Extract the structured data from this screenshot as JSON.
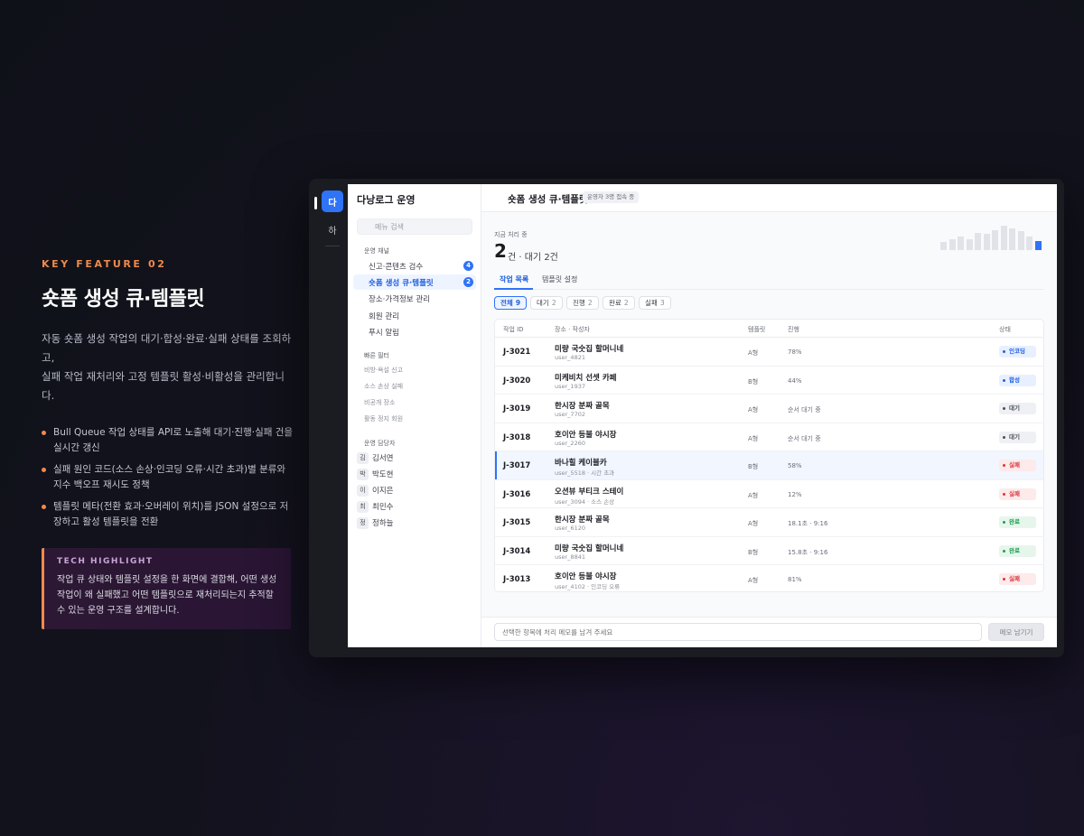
{
  "feature": {
    "kicker": "KEY FEATURE 02",
    "title": "숏폼 생성 큐·템플릿",
    "desc_line1": "자동 숏폼 생성 작업의 대기·합성·완료·실패 상태를 조회하고,",
    "desc_line2": "실패 작업 재처리와 고정 템플릿 활성·비활성을 관리합니다.",
    "bullets": [
      "Bull Queue 작업 상태를 API로 노출해 대기·진행·실패 건을 실시간 갱신",
      "실패 원인 코드(소스 손상·인코딩 오류·시간 초과)별 분류와 지수 백오프 재시도 정책",
      "템플릿 메타(전환 효과·오버레이 위치)를 JSON 설정으로 저장하고 활성 템플릿을 전환"
    ],
    "tech_title": "TECH HIGHLIGHT",
    "tech_body": "작업 큐 상태와 템플릿 설정을 한 화면에 결합해, 어떤 생성 작업이 왜 실패했고 어떤 템플릿으로 재처리되는지 추적할 수 있는 운영 구조를 설계합니다."
  },
  "rail": {
    "active": "다",
    "second": "하"
  },
  "sidebar": {
    "brand": "다낭로그 운영",
    "search_placeholder": "메뉴 검색",
    "ops_label": "운영 채널",
    "nav": [
      {
        "label": "신고·콘텐츠 검수",
        "badge": "4"
      },
      {
        "label": "숏폼 생성 큐·템플릿",
        "badge": "2"
      },
      {
        "label": "장소·가격정보 관리"
      },
      {
        "label": "회원 관리"
      },
      {
        "label": "푸시 알림"
      }
    ],
    "quick_label": "빠른 필터",
    "filters": [
      "비방·욕설 신고",
      "소스 손상 실패",
      "비공개 장소",
      "활동 정지 회원"
    ],
    "staff_label": "운영 담당자",
    "staff": [
      {
        "initial": "김",
        "name": "김서연"
      },
      {
        "initial": "박",
        "name": "박도현"
      },
      {
        "initial": "이",
        "name": "이지은"
      },
      {
        "initial": "최",
        "name": "최민수"
      },
      {
        "initial": "정",
        "name": "정하늘"
      }
    ]
  },
  "header": {
    "title": "숏폼 생성 큐·템플릿",
    "presence": "운영자 3명 접속 중"
  },
  "summary": {
    "label": "지금 처리 중",
    "count": "2",
    "suffix": "건 · 대기 2건",
    "spark": [
      0.3,
      0.4,
      0.5,
      0.4,
      0.65,
      0.6,
      0.75,
      0.9,
      0.8,
      0.7,
      0.5,
      0.35
    ]
  },
  "tabs": [
    "작업 목록",
    "템플릿 설정"
  ],
  "chips": [
    {
      "label": "전체",
      "count": "9"
    },
    {
      "label": "대기",
      "count": "2"
    },
    {
      "label": "진행",
      "count": "2"
    },
    {
      "label": "완료",
      "count": "2"
    },
    {
      "label": "실패",
      "count": "3"
    }
  ],
  "table": {
    "headers": [
      "작업 ID",
      "장소 · 작성자",
      "템플릿",
      "진행",
      "상태"
    ],
    "rows": [
      {
        "id": "J-3021",
        "place": "미량 국숫집 할머니네",
        "user": "user_4821",
        "tpl": "A형",
        "prog": "78%",
        "status": "인코딩",
        "kind": "enc"
      },
      {
        "id": "J-3020",
        "place": "미케비치 선셋 카페",
        "user": "user_1937",
        "tpl": "B형",
        "prog": "44%",
        "status": "합성",
        "kind": "enc"
      },
      {
        "id": "J-3019",
        "place": "한시장 분짜 골목",
        "user": "user_7702",
        "tpl": "A형",
        "prog": "순서 대기 중",
        "status": "대기",
        "kind": "wait"
      },
      {
        "id": "J-3018",
        "place": "호이안 등불 야시장",
        "user": "user_2260",
        "tpl": "A형",
        "prog": "순서 대기 중",
        "status": "대기",
        "kind": "wait"
      },
      {
        "id": "J-3017",
        "place": "바나힐 케이블카",
        "user": "user_5518 · 시간 초과",
        "tpl": "B형",
        "prog": "58%",
        "status": "실패",
        "kind": "fail"
      },
      {
        "id": "J-3016",
        "place": "오션뷰 부티크 스테이",
        "user": "user_3094 · 소스 손상",
        "tpl": "A형",
        "prog": "12%",
        "status": "실패",
        "kind": "fail"
      },
      {
        "id": "J-3015",
        "place": "한시장 분짜 골목",
        "user": "user_6120",
        "tpl": "A형",
        "prog": "18.1초 · 9:16",
        "status": "완료",
        "kind": "done"
      },
      {
        "id": "J-3014",
        "place": "미량 국숫집 할머니네",
        "user": "user_8841",
        "tpl": "B형",
        "prog": "15.8초 · 9:16",
        "status": "완료",
        "kind": "done"
      },
      {
        "id": "J-3013",
        "place": "호이안 등불 야시장",
        "user": "user_4102 · 인코딩 오류",
        "tpl": "A형",
        "prog": "81%",
        "status": "실패",
        "kind": "fail"
      }
    ]
  },
  "status_colors": {
    "enc": {
      "fg": "#1f5fe0",
      "bg": "#e8f0ff"
    },
    "wait": {
      "fg": "#4a4d57",
      "bg": "#eff0f3"
    },
    "fail": {
      "fg": "#d9363e",
      "bg": "#fdeaea"
    },
    "done": {
      "fg": "#1f9d55",
      "bg": "#e6f6ec"
    }
  },
  "footer": {
    "placeholder": "선택한 항목에 처리 메모를 남겨 주세요",
    "button": "메모 남기기"
  }
}
